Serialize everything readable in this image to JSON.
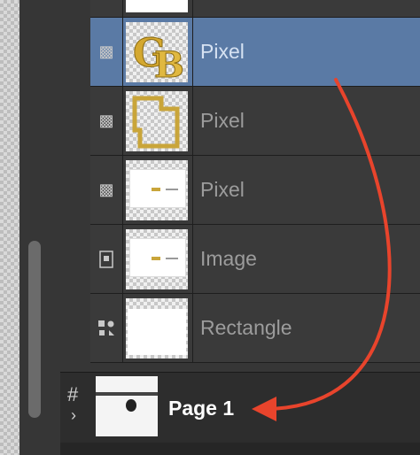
{
  "layers": [
    {
      "name": "Pixel",
      "kind": "pixel",
      "vis_icon": "checker-icon",
      "thumb": "gb-logo",
      "selected": true
    },
    {
      "name": "Pixel",
      "kind": "pixel",
      "vis_icon": "checker-icon",
      "thumb": "gb-outline",
      "selected": false
    },
    {
      "name": "Pixel",
      "kind": "pixel",
      "vis_icon": "checker-icon",
      "thumb": "document",
      "selected": false
    },
    {
      "name": "Image",
      "kind": "image",
      "vis_icon": "image-icon",
      "thumb": "document",
      "selected": false
    },
    {
      "name": "Rectangle",
      "kind": "shape",
      "vis_icon": "shapes-icon",
      "thumb": "white-rect",
      "selected": false
    }
  ],
  "page": {
    "name": "Page 1",
    "icons": [
      "hash-icon",
      "chevron-right-icon"
    ]
  },
  "colors": {
    "selection": "#5a7aa5",
    "arrow": "#e8442c",
    "panel": "#363636"
  }
}
